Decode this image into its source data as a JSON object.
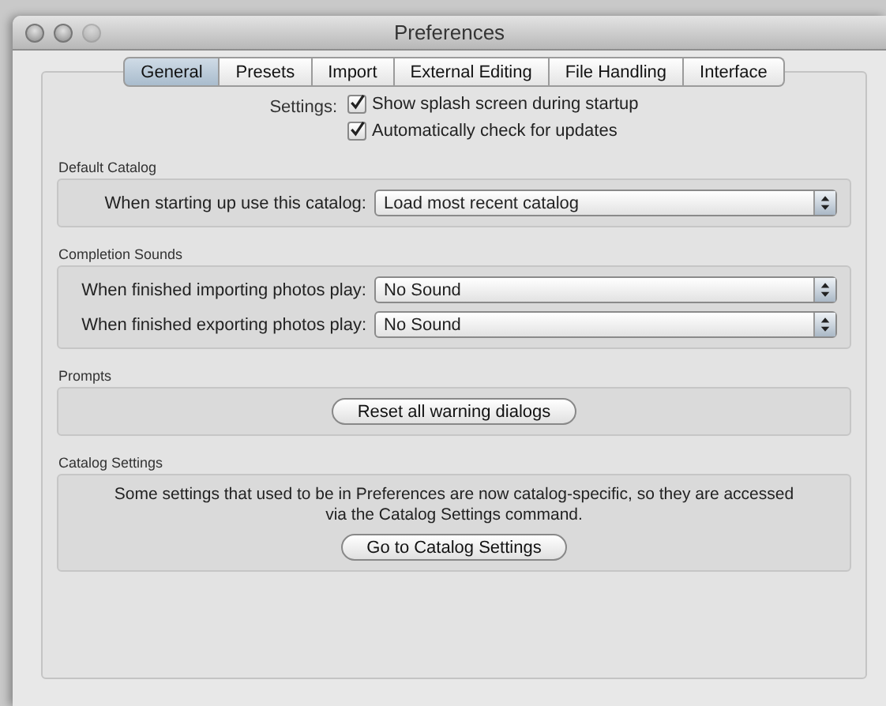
{
  "window": {
    "title": "Preferences"
  },
  "tabs": [
    {
      "label": "General",
      "selected": true
    },
    {
      "label": "Presets",
      "selected": false
    },
    {
      "label": "Import",
      "selected": false
    },
    {
      "label": "External Editing",
      "selected": false
    },
    {
      "label": "File Handling",
      "selected": false
    },
    {
      "label": "Interface",
      "selected": false
    }
  ],
  "settings": {
    "label": "Settings:",
    "options": [
      {
        "label": "Show splash screen during startup",
        "checked": true
      },
      {
        "label": "Automatically check for updates",
        "checked": true
      }
    ]
  },
  "sections": [
    {
      "title": "Default Catalog",
      "kind": "selects",
      "rows": [
        {
          "label": "When starting up use this catalog:",
          "value": "Load most recent catalog"
        }
      ]
    },
    {
      "title": "Completion Sounds",
      "kind": "selects",
      "rows": [
        {
          "label": "When finished importing photos play:",
          "value": "No Sound"
        },
        {
          "label": "When finished exporting photos play:",
          "value": "No Sound"
        }
      ]
    },
    {
      "title": "Prompts",
      "kind": "button",
      "button": "Reset all warning dialogs"
    },
    {
      "title": "Catalog Settings",
      "kind": "message",
      "text": "Some settings that used to be in Preferences are now catalog-specific, so they are accessed via the Catalog Settings command.",
      "button": "Go to Catalog Settings"
    }
  ]
}
